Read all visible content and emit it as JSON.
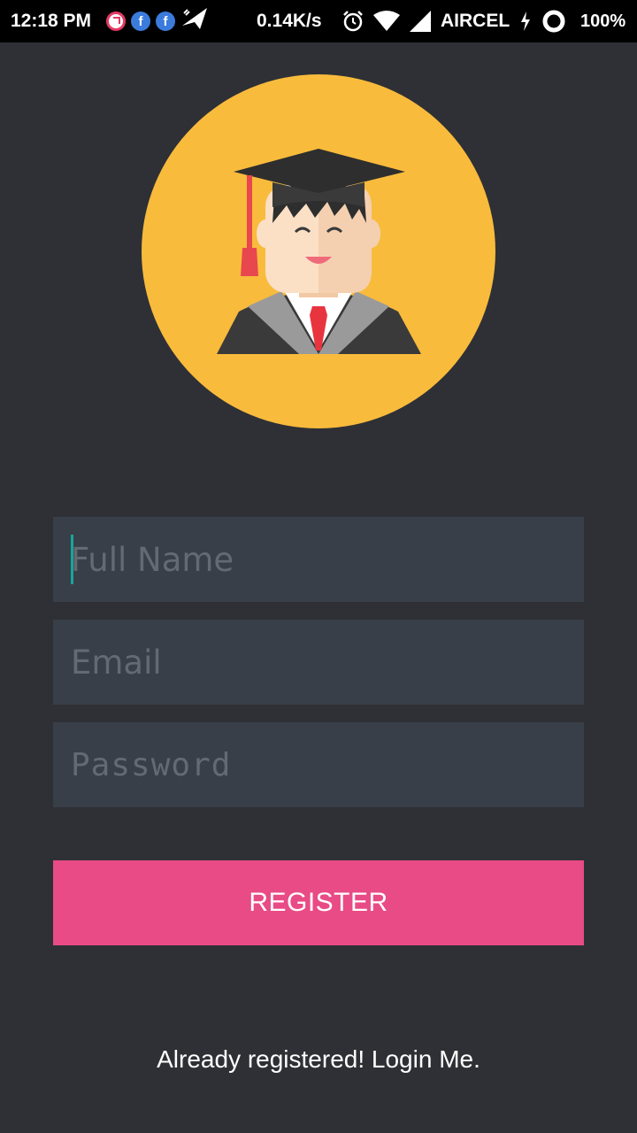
{
  "status_bar": {
    "time": "12:18 PM",
    "net_speed": "0.14K/s",
    "carrier": "AIRCEL",
    "battery": "100%",
    "icons": [
      "clock-notification-icon",
      "facebook-icon",
      "facebook-icon",
      "airplane-icon",
      "alarm-icon",
      "wifi-icon",
      "signal-icon",
      "charging-icon",
      "battery-ring-icon"
    ]
  },
  "avatar": {
    "icon": "graduate-avatar-icon",
    "bg_color": "#f9bb3c"
  },
  "form": {
    "full_name_placeholder": "Full Name",
    "email_placeholder": "Email",
    "password_placeholder": "Password",
    "register_label": "REGISTER",
    "login_link": "Already registered! Login Me."
  },
  "colors": {
    "background": "#2e3035",
    "field_bg": "#393f48",
    "accent": "#e84b85",
    "cursor": "#1aa59a"
  }
}
